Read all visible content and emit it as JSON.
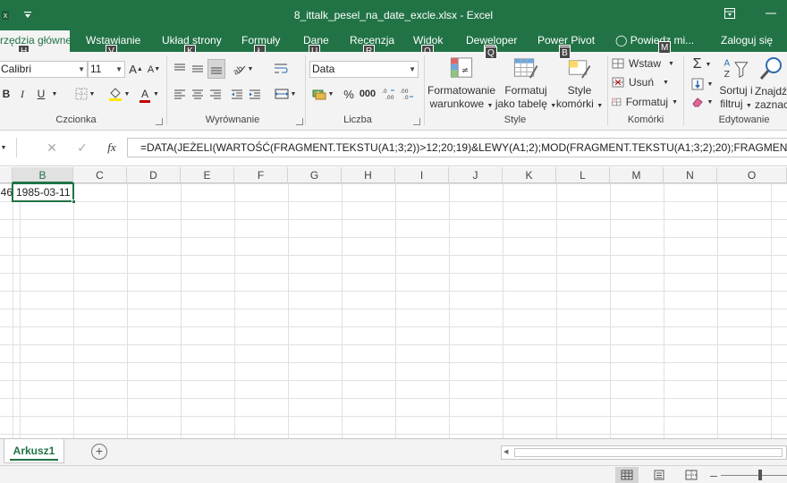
{
  "window": {
    "title": "8_ittalk_pesel_na_date_excle.xlsx - Excel",
    "qat_icons": [
      "excel-logo-icon",
      "customize-qat-icon"
    ],
    "controls": [
      "ribbon-display-options-icon",
      "minimize-icon"
    ]
  },
  "tabs": {
    "items": [
      {
        "label": "rzędzia główne",
        "keytip": "H",
        "active": true
      },
      {
        "label": "Wstawianie",
        "keytip": "V"
      },
      {
        "label": "Układ strony",
        "keytip": "K"
      },
      {
        "label": "Formuły",
        "keytip": "Ł"
      },
      {
        "label": "Dane",
        "keytip": "U"
      },
      {
        "label": "Recenzja",
        "keytip": "R"
      },
      {
        "label": "Widok",
        "keytip": "O"
      },
      {
        "label": "Deweloper",
        "keytip": "Q"
      },
      {
        "label": "Power Pivot",
        "keytip": "B"
      },
      {
        "label": "Powiedz mi...",
        "keytip": "M"
      }
    ],
    "signin": "Zaloguj się"
  },
  "ribbon": {
    "font": {
      "name": "Calibri",
      "size": "11",
      "label": "Czcionka",
      "bold": "B",
      "italic": "I",
      "underline": "U",
      "grow": "A",
      "shrink": "A",
      "fontcolor": "A"
    },
    "alignment": {
      "label": "Wyrównanie"
    },
    "number": {
      "format": "Data",
      "label": "Liczba",
      "percent": "%",
      "comma": "000"
    },
    "styles": {
      "label": "Style",
      "cond_line1": "Formatowanie",
      "cond_line2": "warunkowe",
      "table_line1": "Formatuj",
      "table_line2": "jako tabelę",
      "cell_line1": "Style",
      "cell_line2": "komórki"
    },
    "cells": {
      "label": "Komórki",
      "insert": "Wstaw",
      "delete": "Usuń",
      "format": "Formatuj"
    },
    "editing": {
      "label": "Edytowanie",
      "sort_line1": "Sortuj i",
      "sort_line2": "filtruj",
      "find_line1": "Znajdź",
      "find_line2": "zaznacz"
    }
  },
  "formula_bar": {
    "fx": "fx",
    "formula": "=DATA(JEŻELI(WARTOŚĆ(FRAGMENT.TEKSTU(A1;3;2))>12;20;19)&LEWY(A1;2);MOD(FRAGMENT.TEKSTU(A1;3;2);20);FRAGMENT"
  },
  "grid": {
    "columns": [
      "B",
      "C",
      "D",
      "E",
      "F",
      "G",
      "H",
      "I",
      "J",
      "K",
      "L",
      "M",
      "N",
      "O"
    ],
    "selected_column": "B",
    "a1_partial": "46",
    "b1_value": "1985-03-11"
  },
  "sheets": {
    "items": [
      "Arkusz1"
    ],
    "add": "+"
  },
  "colors": {
    "accent": "#217346",
    "ribbon_bg": "#f3f3f3",
    "gridline": "#e1e1e1"
  }
}
